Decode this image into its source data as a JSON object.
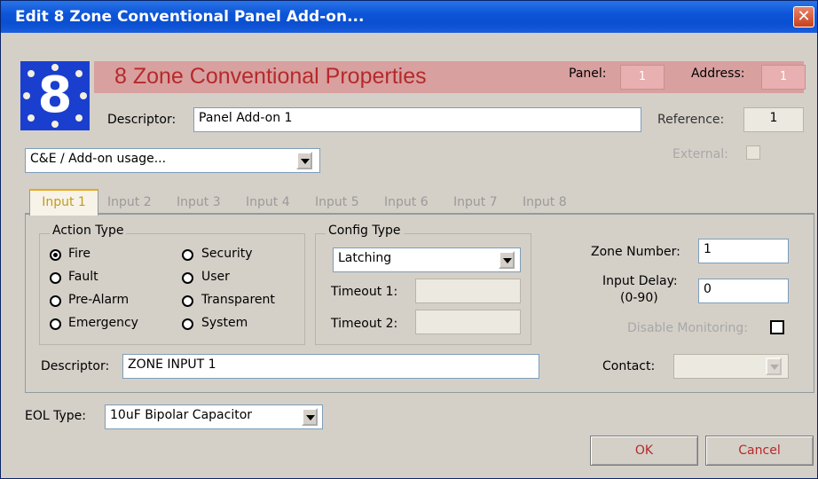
{
  "window": {
    "title": "Edit 8 Zone Conventional Panel Add-on..."
  },
  "header": {
    "title": "8 Zone Conventional Properties",
    "panel_label": "Panel:",
    "panel_value": "1",
    "address_label": "Address:",
    "address_value": "1",
    "logo_digit": "8"
  },
  "descriptor": {
    "label": "Descriptor:",
    "value": "Panel Add-on 1"
  },
  "reference": {
    "label": "Reference:",
    "value": "1"
  },
  "usage_select": {
    "value": "C&E / Add-on usage..."
  },
  "external": {
    "label": "External:"
  },
  "tabs": [
    {
      "label": "Input 1"
    },
    {
      "label": "Input 2"
    },
    {
      "label": "Input 3"
    },
    {
      "label": "Input 4"
    },
    {
      "label": "Input 5"
    },
    {
      "label": "Input 6"
    },
    {
      "label": "Input 7"
    },
    {
      "label": "Input 8"
    }
  ],
  "action_type": {
    "title": "Action Type",
    "options": [
      {
        "label": "Fire",
        "selected": true
      },
      {
        "label": "Security",
        "selected": false
      },
      {
        "label": "Fault",
        "selected": false
      },
      {
        "label": "User",
        "selected": false
      },
      {
        "label": "Pre-Alarm",
        "selected": false
      },
      {
        "label": "Transparent",
        "selected": false
      },
      {
        "label": "Emergency",
        "selected": false
      },
      {
        "label": "System",
        "selected": false
      }
    ]
  },
  "config_type": {
    "title": "Config Type",
    "value": "Latching",
    "timeout1_label": "Timeout 1:",
    "timeout2_label": "Timeout 2:"
  },
  "zone_number": {
    "label": "Zone Number:",
    "value": "1"
  },
  "input_delay": {
    "label_line1": "Input Delay:",
    "label_line2": "(0-90)",
    "value": "0"
  },
  "disable_monitoring": {
    "label": "Disable Monitoring:"
  },
  "contact": {
    "label": "Contact:"
  },
  "input_descriptor": {
    "label": "Descriptor:",
    "value": "ZONE INPUT 1"
  },
  "eol_type": {
    "label": "EOL Type:",
    "value": "10uF Bipolar Capacitor"
  },
  "buttons": {
    "ok": "OK",
    "cancel": "Cancel"
  },
  "colors": {
    "titlebar": "#0a4fd0",
    "header_band": "#d9a0a0",
    "header_title": "#b52a2a",
    "active_tab_text": "#c49a1c"
  }
}
